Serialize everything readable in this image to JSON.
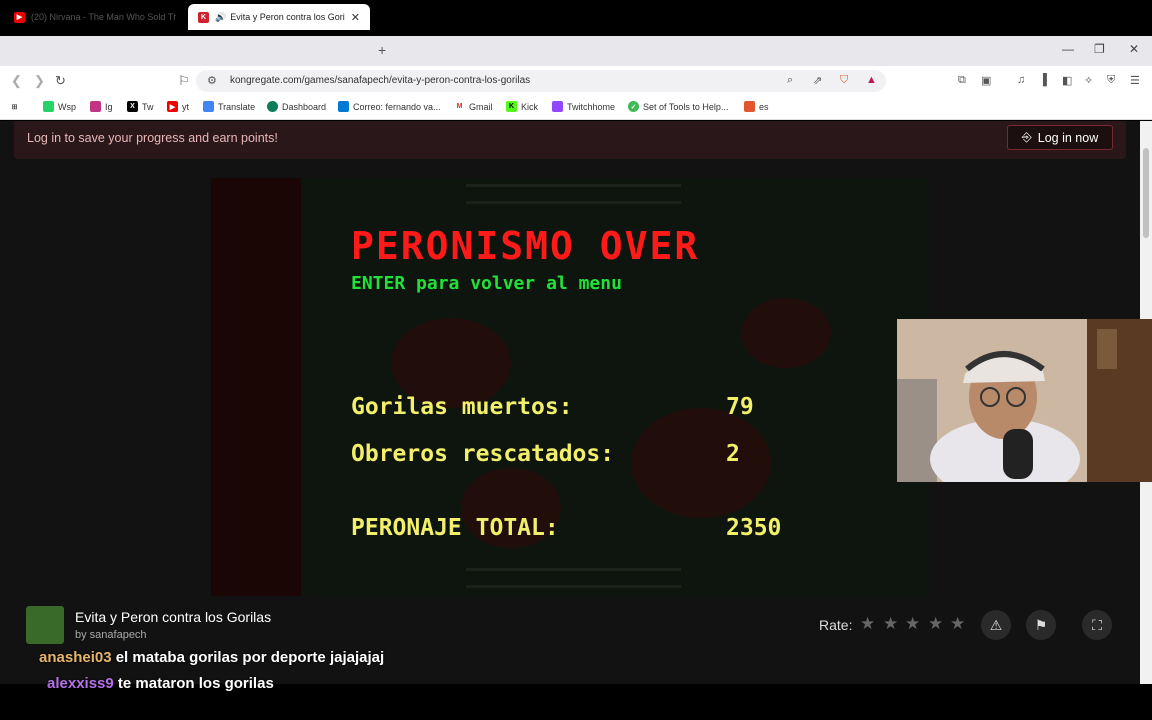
{
  "browser": {
    "tabs": [
      {
        "title": "(20) Nirvana - The Man Who Sold Th",
        "active": false
      },
      {
        "title": "Evita y Peron contra los Gorila",
        "active": true
      }
    ],
    "url": "kongregate.com/games/sanafapech/evita-y-peron-contra-los-gorilas",
    "bookmarks": [
      "Wsp",
      "Ig",
      "Tw",
      "yt",
      "Translate",
      "Dashboard",
      "Correo: fernando va...",
      "Gmail",
      "Kick",
      "Twitchhome",
      "Set of Tools to Help...",
      "es"
    ]
  },
  "banner": {
    "message": "Log in to save your progress and earn points!",
    "login_label": "Log in now"
  },
  "game": {
    "over_title": "PERONISMO OVER",
    "enter_hint": "ENTER para volver al menu",
    "stats": [
      {
        "label": "Gorilas muertos:",
        "value": "79"
      },
      {
        "label": "Obreros rescatados:",
        "value": "2"
      }
    ],
    "total_label": "PERONAJE TOTAL:",
    "total_value": "2350"
  },
  "info": {
    "title": "Evita y Peron contra los Gorilas",
    "author": "by sanafapech",
    "rate_label": "Rate:"
  },
  "chat": [
    {
      "user": "anashei03",
      "message": "el mataba gorilas por deporte jajajajaj"
    },
    {
      "user": "alexxiss9",
      "message": "te mataron los gorilas"
    }
  ]
}
